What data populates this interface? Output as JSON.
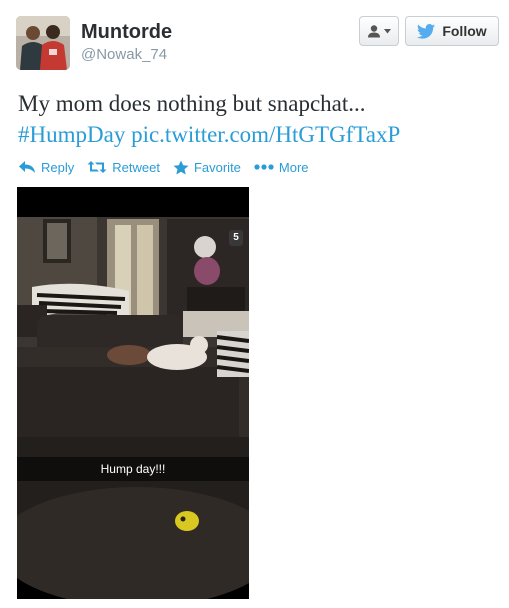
{
  "user": {
    "display_name": "Muntorde",
    "handle": "@Nowak_74"
  },
  "header": {
    "follow_label": "Follow"
  },
  "tweet": {
    "text": "My mom does nothing but snapchat...",
    "hashtag": "#HumpDay",
    "link": "pic.twitter.com/HtGTGfTaxP"
  },
  "actions": [
    {
      "label": "Reply",
      "icon": "reply-icon"
    },
    {
      "label": "Retweet",
      "icon": "retweet-icon"
    },
    {
      "label": "Favorite",
      "icon": "star-icon"
    },
    {
      "label": "More",
      "icon": "more-dots-icon"
    }
  ],
  "media": {
    "caption": "Hump day!!!",
    "timer": "5"
  },
  "colors": {
    "link_blue": "#2a9cd6",
    "handle_gray": "#8899a6",
    "twitter_bird": "#55acee"
  }
}
